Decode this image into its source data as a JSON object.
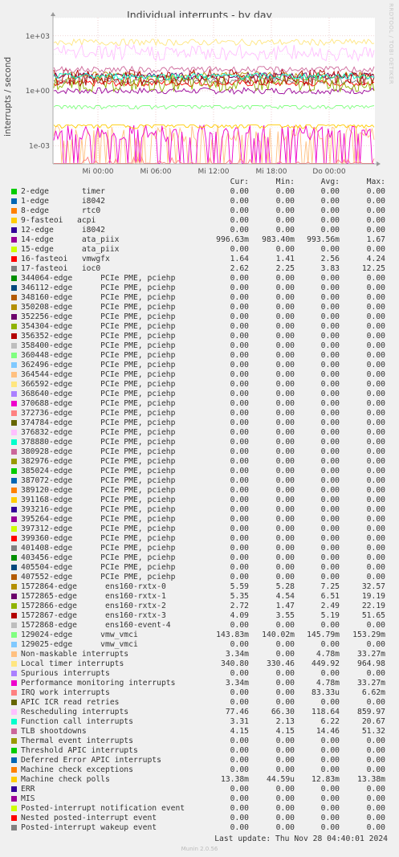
{
  "chart_data": {
    "type": "line",
    "title": "Individual interrupts - by day",
    "ylabel": "interrupts / second",
    "yscale": "log",
    "ylim": [
      0.0001,
      10000
    ],
    "yticks": [
      {
        "value": 1000,
        "label": "1e+03"
      },
      {
        "value": 1,
        "label": "1e+00"
      },
      {
        "value": 0.001,
        "label": "1e-03"
      }
    ],
    "xticks": [
      "Mi 00:00",
      "Mi 06:00",
      "Mi 12:00",
      "Mi 18:00",
      "Do 00:00"
    ],
    "grid": true,
    "watermark": "RRDTOOL / TOBI OETIKER",
    "columns": [
      "Cur:",
      "Min:",
      "Avg:",
      "Max:"
    ],
    "series": [
      {
        "name": "2-edge       timer",
        "color": "#00cc00",
        "cur": "0.00",
        "min": "0.00",
        "avg": "0.00",
        "max": "0.00"
      },
      {
        "name": "1-edge       i8042",
        "color": "#0066b3",
        "cur": "0.00",
        "min": "0.00",
        "avg": "0.00",
        "max": "0.00"
      },
      {
        "name": "8-edge       rtc0",
        "color": "#ff8000",
        "cur": "0.00",
        "min": "0.00",
        "avg": "0.00",
        "max": "0.00"
      },
      {
        "name": "9-fasteoi   acpi",
        "color": "#ffcc00",
        "cur": "0.00",
        "min": "0.00",
        "avg": "0.00",
        "max": "0.00"
      },
      {
        "name": "12-edge      i8042",
        "color": "#330099",
        "cur": "0.00",
        "min": "0.00",
        "avg": "0.00",
        "max": "0.00"
      },
      {
        "name": "14-edge      ata_piix",
        "color": "#990099",
        "cur": "996.63m",
        "min": "983.40m",
        "avg": "993.56m",
        "max": "1.67"
      },
      {
        "name": "15-edge      ata_piix",
        "color": "#ccff00",
        "cur": "0.00",
        "min": "0.00",
        "avg": "0.00",
        "max": "0.00"
      },
      {
        "name": "16-fasteoi   vmwgfx",
        "color": "#ff0000",
        "cur": "1.64",
        "min": "1.41",
        "avg": "2.56",
        "max": "4.24"
      },
      {
        "name": "17-fasteoi   ioc0",
        "color": "#808080",
        "cur": "2.62",
        "min": "2.25",
        "avg": "3.83",
        "max": "12.25"
      },
      {
        "name": "344064-edge      PCIe PME, pciehp",
        "color": "#008f00",
        "cur": "0.00",
        "min": "0.00",
        "avg": "0.00",
        "max": "0.00"
      },
      {
        "name": "346112-edge      PCIe PME, pciehp",
        "color": "#00487d",
        "cur": "0.00",
        "min": "0.00",
        "avg": "0.00",
        "max": "0.00"
      },
      {
        "name": "348160-edge      PCIe PME, pciehp",
        "color": "#b35a00",
        "cur": "0.00",
        "min": "0.00",
        "avg": "0.00",
        "max": "0.00"
      },
      {
        "name": "350208-edge      PCIe PME, pciehp",
        "color": "#b38f00",
        "cur": "0.00",
        "min": "0.00",
        "avg": "0.00",
        "max": "0.00"
      },
      {
        "name": "352256-edge      PCIe PME, pciehp",
        "color": "#6b006b",
        "cur": "0.00",
        "min": "0.00",
        "avg": "0.00",
        "max": "0.00"
      },
      {
        "name": "354304-edge      PCIe PME, pciehp",
        "color": "#8fb300",
        "cur": "0.00",
        "min": "0.00",
        "avg": "0.00",
        "max": "0.00"
      },
      {
        "name": "356352-edge      PCIe PME, pciehp",
        "color": "#b30000",
        "cur": "0.00",
        "min": "0.00",
        "avg": "0.00",
        "max": "0.00"
      },
      {
        "name": "358400-edge      PCIe PME, pciehp",
        "color": "#bebebe",
        "cur": "0.00",
        "min": "0.00",
        "avg": "0.00",
        "max": "0.00"
      },
      {
        "name": "360448-edge      PCIe PME, pciehp",
        "color": "#80ff80",
        "cur": "0.00",
        "min": "0.00",
        "avg": "0.00",
        "max": "0.00"
      },
      {
        "name": "362496-edge      PCIe PME, pciehp",
        "color": "#80c9ff",
        "cur": "0.00",
        "min": "0.00",
        "avg": "0.00",
        "max": "0.00"
      },
      {
        "name": "364544-edge      PCIe PME, pciehp",
        "color": "#ffc080",
        "cur": "0.00",
        "min": "0.00",
        "avg": "0.00",
        "max": "0.00"
      },
      {
        "name": "366592-edge      PCIe PME, pciehp",
        "color": "#ffe680",
        "cur": "0.00",
        "min": "0.00",
        "avg": "0.00",
        "max": "0.00"
      },
      {
        "name": "368640-edge      PCIe PME, pciehp",
        "color": "#aa80ff",
        "cur": "0.00",
        "min": "0.00",
        "avg": "0.00",
        "max": "0.00"
      },
      {
        "name": "370688-edge      PCIe PME, pciehp",
        "color": "#ee00cc",
        "cur": "0.00",
        "min": "0.00",
        "avg": "0.00",
        "max": "0.00"
      },
      {
        "name": "372736-edge      PCIe PME, pciehp",
        "color": "#ff8080",
        "cur": "0.00",
        "min": "0.00",
        "avg": "0.00",
        "max": "0.00"
      },
      {
        "name": "374784-edge      PCIe PME, pciehp",
        "color": "#666600",
        "cur": "0.00",
        "min": "0.00",
        "avg": "0.00",
        "max": "0.00"
      },
      {
        "name": "376832-edge      PCIe PME, pciehp",
        "color": "#ffbfff",
        "cur": "0.00",
        "min": "0.00",
        "avg": "0.00",
        "max": "0.00"
      },
      {
        "name": "378880-edge      PCIe PME, pciehp",
        "color": "#00ffcc",
        "cur": "0.00",
        "min": "0.00",
        "avg": "0.00",
        "max": "0.00"
      },
      {
        "name": "380928-edge      PCIe PME, pciehp",
        "color": "#cc6699",
        "cur": "0.00",
        "min": "0.00",
        "avg": "0.00",
        "max": "0.00"
      },
      {
        "name": "382976-edge      PCIe PME, pciehp",
        "color": "#999900",
        "cur": "0.00",
        "min": "0.00",
        "avg": "0.00",
        "max": "0.00"
      },
      {
        "name": "385024-edge      PCIe PME, pciehp",
        "color": "#00cc00",
        "cur": "0.00",
        "min": "0.00",
        "avg": "0.00",
        "max": "0.00"
      },
      {
        "name": "387072-edge      PCIe PME, pciehp",
        "color": "#0066b3",
        "cur": "0.00",
        "min": "0.00",
        "avg": "0.00",
        "max": "0.00"
      },
      {
        "name": "389120-edge      PCIe PME, pciehp",
        "color": "#ff8000",
        "cur": "0.00",
        "min": "0.00",
        "avg": "0.00",
        "max": "0.00"
      },
      {
        "name": "391168-edge      PCIe PME, pciehp",
        "color": "#ffcc00",
        "cur": "0.00",
        "min": "0.00",
        "avg": "0.00",
        "max": "0.00"
      },
      {
        "name": "393216-edge      PCIe PME, pciehp",
        "color": "#330099",
        "cur": "0.00",
        "min": "0.00",
        "avg": "0.00",
        "max": "0.00"
      },
      {
        "name": "395264-edge      PCIe PME, pciehp",
        "color": "#990099",
        "cur": "0.00",
        "min": "0.00",
        "avg": "0.00",
        "max": "0.00"
      },
      {
        "name": "397312-edge      PCIe PME, pciehp",
        "color": "#ccff00",
        "cur": "0.00",
        "min": "0.00",
        "avg": "0.00",
        "max": "0.00"
      },
      {
        "name": "399360-edge      PCIe PME, pciehp",
        "color": "#ff0000",
        "cur": "0.00",
        "min": "0.00",
        "avg": "0.00",
        "max": "0.00"
      },
      {
        "name": "401408-edge      PCIe PME, pciehp",
        "color": "#808080",
        "cur": "0.00",
        "min": "0.00",
        "avg": "0.00",
        "max": "0.00"
      },
      {
        "name": "403456-edge      PCIe PME, pciehp",
        "color": "#008f00",
        "cur": "0.00",
        "min": "0.00",
        "avg": "0.00",
        "max": "0.00"
      },
      {
        "name": "405504-edge      PCIe PME, pciehp",
        "color": "#00487d",
        "cur": "0.00",
        "min": "0.00",
        "avg": "0.00",
        "max": "0.00"
      },
      {
        "name": "407552-edge      PCIe PME, pciehp",
        "color": "#b35a00",
        "cur": "0.00",
        "min": "0.00",
        "avg": "0.00",
        "max": "0.00"
      },
      {
        "name": "1572864-edge      ens160-rxtx-0",
        "color": "#b38f00",
        "cur": "5.59",
        "min": "5.28",
        "avg": "7.25",
        "max": "32.57"
      },
      {
        "name": "1572865-edge      ens160-rxtx-1",
        "color": "#6b006b",
        "cur": "5.35",
        "min": "4.54",
        "avg": "6.51",
        "max": "19.19"
      },
      {
        "name": "1572866-edge      ens160-rxtx-2",
        "color": "#8fb300",
        "cur": "2.72",
        "min": "1.47",
        "avg": "2.49",
        "max": "22.19"
      },
      {
        "name": "1572867-edge      ens160-rxtx-3",
        "color": "#b30000",
        "cur": "4.09",
        "min": "3.55",
        "avg": "5.19",
        "max": "51.65"
      },
      {
        "name": "1572868-edge      ens160-event-4",
        "color": "#bebebe",
        "cur": "0.00",
        "min": "0.00",
        "avg": "0.00",
        "max": "0.00"
      },
      {
        "name": "129024-edge      vmw_vmci",
        "color": "#80ff80",
        "cur": "143.83m",
        "min": "140.02m",
        "avg": "145.79m",
        "max": "153.29m"
      },
      {
        "name": "129025-edge      vmw_vmci",
        "color": "#80c9ff",
        "cur": "0.00",
        "min": "0.00",
        "avg": "0.00",
        "max": "0.00"
      },
      {
        "name": "Non-maskable interrupts",
        "color": "#ffc080",
        "cur": "3.34m",
        "min": "0.00",
        "avg": "4.78m",
        "max": "33.27m"
      },
      {
        "name": "Local timer interrupts",
        "color": "#ffe680",
        "cur": "340.80",
        "min": "330.46",
        "avg": "449.92",
        "max": "964.98"
      },
      {
        "name": "Spurious interrupts",
        "color": "#aa80ff",
        "cur": "0.00",
        "min": "0.00",
        "avg": "0.00",
        "max": "0.00"
      },
      {
        "name": "Performance monitoring interrupts",
        "color": "#ee00cc",
        "cur": "3.34m",
        "min": "0.00",
        "avg": "4.78m",
        "max": "33.27m"
      },
      {
        "name": "IRQ work interrupts",
        "color": "#ff8080",
        "cur": "0.00",
        "min": "0.00",
        "avg": "83.33u",
        "max": "6.62m"
      },
      {
        "name": "APIC ICR read retries",
        "color": "#666600",
        "cur": "0.00",
        "min": "0.00",
        "avg": "0.00",
        "max": "0.00"
      },
      {
        "name": "Rescheduling interrupts",
        "color": "#ffbfff",
        "cur": "77.46",
        "min": "66.30",
        "avg": "118.64",
        "max": "859.97"
      },
      {
        "name": "Function call interrupts",
        "color": "#00ffcc",
        "cur": "3.31",
        "min": "2.13",
        "avg": "6.22",
        "max": "20.67"
      },
      {
        "name": "TLB shootdowns",
        "color": "#cc6699",
        "cur": "4.15",
        "min": "4.15",
        "avg": "14.46",
        "max": "51.32"
      },
      {
        "name": "Thermal event interrupts",
        "color": "#999900",
        "cur": "0.00",
        "min": "0.00",
        "avg": "0.00",
        "max": "0.00"
      },
      {
        "name": "Threshold APIC interrupts",
        "color": "#00cc00",
        "cur": "0.00",
        "min": "0.00",
        "avg": "0.00",
        "max": "0.00"
      },
      {
        "name": "Deferred Error APIC interrupts",
        "color": "#0066b3",
        "cur": "0.00",
        "min": "0.00",
        "avg": "0.00",
        "max": "0.00"
      },
      {
        "name": "Machine check exceptions",
        "color": "#ff8000",
        "cur": "0.00",
        "min": "0.00",
        "avg": "0.00",
        "max": "0.00"
      },
      {
        "name": "Machine check polls",
        "color": "#ffcc00",
        "cur": "13.38m",
        "min": "44.59u",
        "avg": "12.83m",
        "max": "13.38m"
      },
      {
        "name": "ERR",
        "color": "#330099",
        "cur": "0.00",
        "min": "0.00",
        "avg": "0.00",
        "max": "0.00"
      },
      {
        "name": "MIS",
        "color": "#990099",
        "cur": "0.00",
        "min": "0.00",
        "avg": "0.00",
        "max": "0.00"
      },
      {
        "name": "Posted-interrupt notification event",
        "color": "#ccff00",
        "cur": "0.00",
        "min": "0.00",
        "avg": "0.00",
        "max": "0.00"
      },
      {
        "name": "Nested posted-interrupt event",
        "color": "#ff0000",
        "cur": "0.00",
        "min": "0.00",
        "avg": "0.00",
        "max": "0.00"
      },
      {
        "name": "Posted-interrupt wakeup event",
        "color": "#808080",
        "cur": "0.00",
        "min": "0.00",
        "avg": "0.00",
        "max": "0.00"
      }
    ]
  },
  "footer": {
    "last_update": "Last update: Thu Nov 28 04:40:01 2024",
    "munin": "Munin 2.0.56"
  }
}
